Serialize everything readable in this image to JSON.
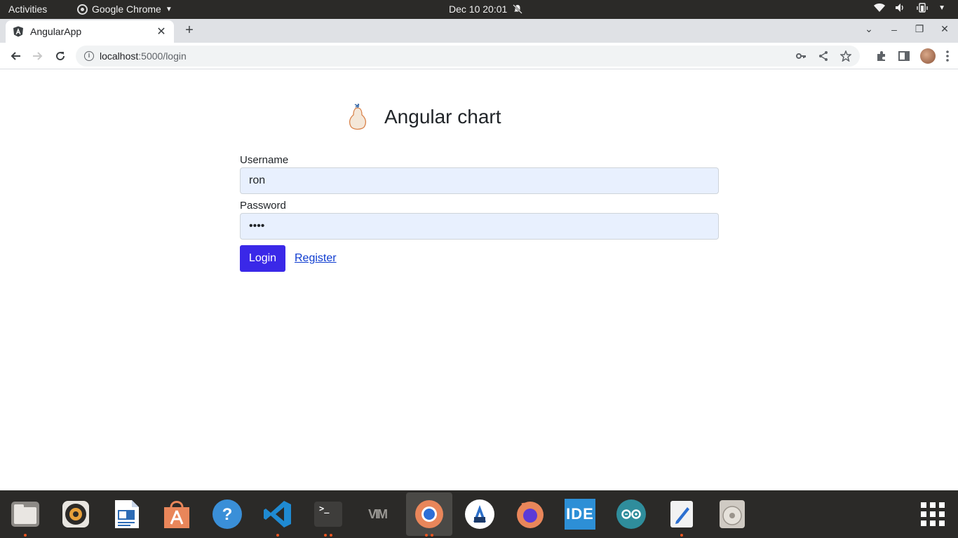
{
  "system_bar": {
    "activities": "Activities",
    "app_name": "Google Chrome",
    "datetime": "Dec 10  20:01"
  },
  "browser": {
    "tab_title": "AngularApp",
    "url_host": "localhost",
    "url_path": ":5000/login"
  },
  "page": {
    "title": "Angular chart",
    "username_label": "Username",
    "username_value": "ron",
    "password_label": "Password",
    "password_value": "••••",
    "login_button": "Login",
    "register_link": "Register"
  },
  "colors": {
    "login_button": "#3a28e8",
    "input_background": "#e8f0fe",
    "link": "#0d3bd0",
    "dock_background": "#2b2a28"
  },
  "dock": {
    "items": [
      {
        "name": "files-icon"
      },
      {
        "name": "rhythmbox-icon"
      },
      {
        "name": "libreoffice-writer-icon"
      },
      {
        "name": "ubuntu-software-icon"
      },
      {
        "name": "help-icon"
      },
      {
        "name": "vscode-icon"
      },
      {
        "name": "terminal-icon"
      },
      {
        "name": "vim-icon"
      },
      {
        "name": "chrome-icon"
      },
      {
        "name": "android-studio-icon"
      },
      {
        "name": "firefox-icon"
      },
      {
        "name": "ide-icon",
        "label": "IDE"
      },
      {
        "name": "arduino-icon"
      },
      {
        "name": "text-editor-icon"
      },
      {
        "name": "disks-icon"
      }
    ]
  }
}
